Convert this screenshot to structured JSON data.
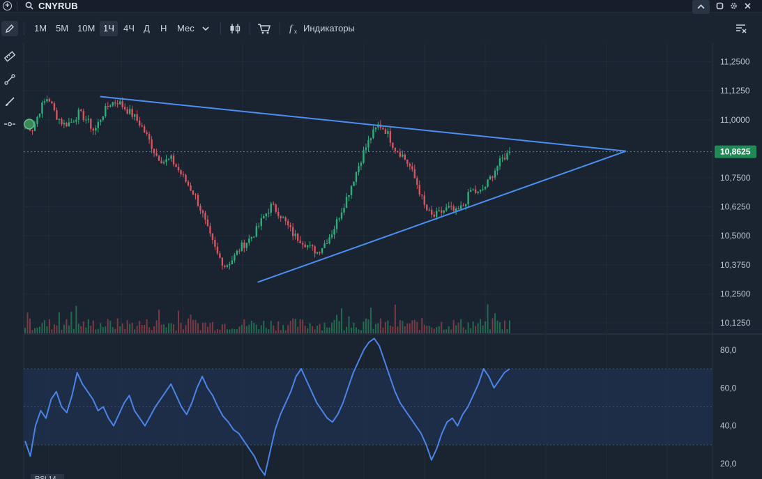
{
  "header": {
    "symbol": "CNYRUB"
  },
  "toolbar": {
    "timeframes": [
      "1M",
      "5M",
      "10M",
      "1Ч",
      "4Ч",
      "Д",
      "Н",
      "Мес"
    ],
    "active_timeframe": "1Ч",
    "indicators_label": "Индикаторы"
  },
  "left_tools": [
    "ruler-icon",
    "trend-line-icon",
    "brush-icon",
    "horizontal-line-icon"
  ],
  "chart_data": [
    {
      "type": "candlestick",
      "symbol": "CNYRUB",
      "interval": "1Ч",
      "y_ticks": [
        "11,2500",
        "11,1250",
        "11,0000",
        "10,7500",
        "10,6250",
        "10,5000",
        "10,3750",
        "10,2500",
        "10,1250"
      ],
      "ylim": [
        10.08,
        11.33
      ],
      "current_price": "10,8625",
      "current_price_value": 10.8625,
      "price_path": [
        10.98,
        10.96,
        11.05,
        11.1,
        11.02,
        10.98,
        10.99,
        11.03,
        11.0,
        10.95,
        11.02,
        11.07,
        11.08,
        11.05,
        11.02,
        10.98,
        10.92,
        10.85,
        10.82,
        10.83,
        10.78,
        10.73,
        10.68,
        10.6,
        10.5,
        10.42,
        10.37,
        10.4,
        10.45,
        10.48,
        10.52,
        10.58,
        10.63,
        10.6,
        10.55,
        10.5,
        10.48,
        10.45,
        10.43,
        10.47,
        10.52,
        10.6,
        10.68,
        10.77,
        10.86,
        10.93,
        10.98,
        10.95,
        10.88,
        10.85,
        10.8,
        10.72,
        10.62,
        10.58,
        10.6,
        10.62,
        10.6,
        10.63,
        10.7,
        10.68,
        10.72,
        10.78,
        10.83,
        10.86
      ],
      "trendlines": [
        {
          "from": {
            "index": 0.155,
            "price": 11.1
          },
          "to": {
            "index": 1.24,
            "price": 10.865
          }
        },
        {
          "from": {
            "index": 0.48,
            "price": 10.3
          },
          "to": {
            "index": 1.24,
            "price": 10.865
          }
        }
      ]
    },
    {
      "type": "volume",
      "note": ""
    },
    {
      "type": "line",
      "name": "RSI 14",
      "y_ticks": [
        "80,0",
        "60,0",
        "40,0",
        "20,0"
      ],
      "ylim": [
        12,
        88
      ],
      "bands": [
        30,
        50,
        70
      ],
      "values": [
        32,
        24,
        40,
        48,
        44,
        54,
        58,
        50,
        47,
        56,
        68,
        62,
        58,
        54,
        48,
        50,
        44,
        40,
        46,
        52,
        56,
        48,
        44,
        40,
        45,
        50,
        54,
        58,
        62,
        56,
        50,
        46,
        52,
        60,
        66,
        60,
        56,
        50,
        45,
        42,
        38,
        36,
        32,
        28,
        24,
        18,
        14,
        26,
        38,
        46,
        52,
        58,
        66,
        70,
        64,
        58,
        52,
        48,
        44,
        42,
        46,
        52,
        60,
        68,
        74,
        80,
        84,
        86,
        82,
        74,
        66,
        58,
        52,
        48,
        44,
        40,
        36,
        30,
        22,
        28,
        36,
        42,
        44,
        40,
        46,
        50,
        56,
        62,
        70,
        66,
        60,
        64,
        68,
        70
      ]
    }
  ],
  "rsi_label": "RSI 14",
  "colors": {
    "background": "#1a2330",
    "up": "#2fae7a",
    "down": "#d8545f",
    "trendline": "#4b8ff0",
    "rsi_line": "#4a84e8",
    "rsi_band_fill": "#1f2f4a",
    "current_price_badge": "#1f8a56"
  }
}
